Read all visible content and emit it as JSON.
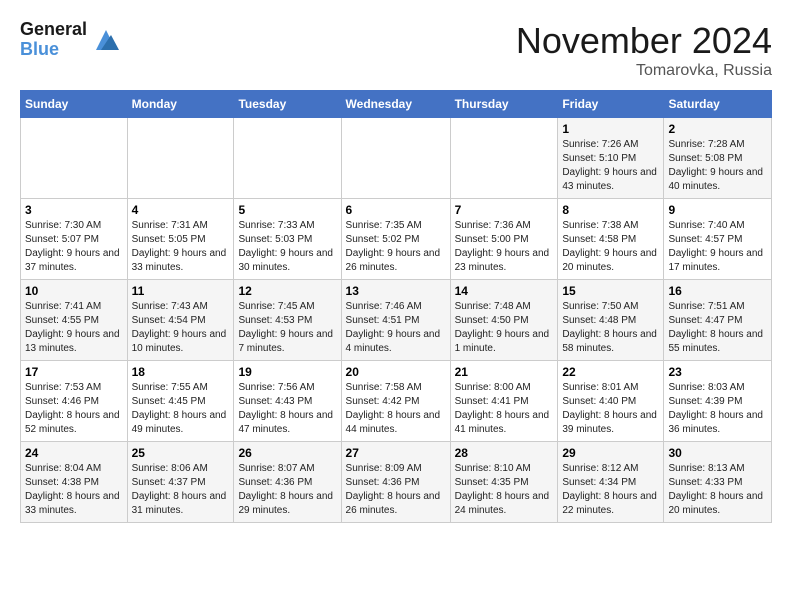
{
  "header": {
    "logo_line1": "General",
    "logo_line2": "Blue",
    "month": "November 2024",
    "location": "Tomarovka, Russia"
  },
  "days_of_week": [
    "Sunday",
    "Monday",
    "Tuesday",
    "Wednesday",
    "Thursday",
    "Friday",
    "Saturday"
  ],
  "weeks": [
    [
      {
        "day": "",
        "info": ""
      },
      {
        "day": "",
        "info": ""
      },
      {
        "day": "",
        "info": ""
      },
      {
        "day": "",
        "info": ""
      },
      {
        "day": "",
        "info": ""
      },
      {
        "day": "1",
        "info": "Sunrise: 7:26 AM\nSunset: 5:10 PM\nDaylight: 9 hours and 43 minutes."
      },
      {
        "day": "2",
        "info": "Sunrise: 7:28 AM\nSunset: 5:08 PM\nDaylight: 9 hours and 40 minutes."
      }
    ],
    [
      {
        "day": "3",
        "info": "Sunrise: 7:30 AM\nSunset: 5:07 PM\nDaylight: 9 hours and 37 minutes."
      },
      {
        "day": "4",
        "info": "Sunrise: 7:31 AM\nSunset: 5:05 PM\nDaylight: 9 hours and 33 minutes."
      },
      {
        "day": "5",
        "info": "Sunrise: 7:33 AM\nSunset: 5:03 PM\nDaylight: 9 hours and 30 minutes."
      },
      {
        "day": "6",
        "info": "Sunrise: 7:35 AM\nSunset: 5:02 PM\nDaylight: 9 hours and 26 minutes."
      },
      {
        "day": "7",
        "info": "Sunrise: 7:36 AM\nSunset: 5:00 PM\nDaylight: 9 hours and 23 minutes."
      },
      {
        "day": "8",
        "info": "Sunrise: 7:38 AM\nSunset: 4:58 PM\nDaylight: 9 hours and 20 minutes."
      },
      {
        "day": "9",
        "info": "Sunrise: 7:40 AM\nSunset: 4:57 PM\nDaylight: 9 hours and 17 minutes."
      }
    ],
    [
      {
        "day": "10",
        "info": "Sunrise: 7:41 AM\nSunset: 4:55 PM\nDaylight: 9 hours and 13 minutes."
      },
      {
        "day": "11",
        "info": "Sunrise: 7:43 AM\nSunset: 4:54 PM\nDaylight: 9 hours and 10 minutes."
      },
      {
        "day": "12",
        "info": "Sunrise: 7:45 AM\nSunset: 4:53 PM\nDaylight: 9 hours and 7 minutes."
      },
      {
        "day": "13",
        "info": "Sunrise: 7:46 AM\nSunset: 4:51 PM\nDaylight: 9 hours and 4 minutes."
      },
      {
        "day": "14",
        "info": "Sunrise: 7:48 AM\nSunset: 4:50 PM\nDaylight: 9 hours and 1 minute."
      },
      {
        "day": "15",
        "info": "Sunrise: 7:50 AM\nSunset: 4:48 PM\nDaylight: 8 hours and 58 minutes."
      },
      {
        "day": "16",
        "info": "Sunrise: 7:51 AM\nSunset: 4:47 PM\nDaylight: 8 hours and 55 minutes."
      }
    ],
    [
      {
        "day": "17",
        "info": "Sunrise: 7:53 AM\nSunset: 4:46 PM\nDaylight: 8 hours and 52 minutes."
      },
      {
        "day": "18",
        "info": "Sunrise: 7:55 AM\nSunset: 4:45 PM\nDaylight: 8 hours and 49 minutes."
      },
      {
        "day": "19",
        "info": "Sunrise: 7:56 AM\nSunset: 4:43 PM\nDaylight: 8 hours and 47 minutes."
      },
      {
        "day": "20",
        "info": "Sunrise: 7:58 AM\nSunset: 4:42 PM\nDaylight: 8 hours and 44 minutes."
      },
      {
        "day": "21",
        "info": "Sunrise: 8:00 AM\nSunset: 4:41 PM\nDaylight: 8 hours and 41 minutes."
      },
      {
        "day": "22",
        "info": "Sunrise: 8:01 AM\nSunset: 4:40 PM\nDaylight: 8 hours and 39 minutes."
      },
      {
        "day": "23",
        "info": "Sunrise: 8:03 AM\nSunset: 4:39 PM\nDaylight: 8 hours and 36 minutes."
      }
    ],
    [
      {
        "day": "24",
        "info": "Sunrise: 8:04 AM\nSunset: 4:38 PM\nDaylight: 8 hours and 33 minutes."
      },
      {
        "day": "25",
        "info": "Sunrise: 8:06 AM\nSunset: 4:37 PM\nDaylight: 8 hours and 31 minutes."
      },
      {
        "day": "26",
        "info": "Sunrise: 8:07 AM\nSunset: 4:36 PM\nDaylight: 8 hours and 29 minutes."
      },
      {
        "day": "27",
        "info": "Sunrise: 8:09 AM\nSunset: 4:36 PM\nDaylight: 8 hours and 26 minutes."
      },
      {
        "day": "28",
        "info": "Sunrise: 8:10 AM\nSunset: 4:35 PM\nDaylight: 8 hours and 24 minutes."
      },
      {
        "day": "29",
        "info": "Sunrise: 8:12 AM\nSunset: 4:34 PM\nDaylight: 8 hours and 22 minutes."
      },
      {
        "day": "30",
        "info": "Sunrise: 8:13 AM\nSunset: 4:33 PM\nDaylight: 8 hours and 20 minutes."
      }
    ]
  ]
}
